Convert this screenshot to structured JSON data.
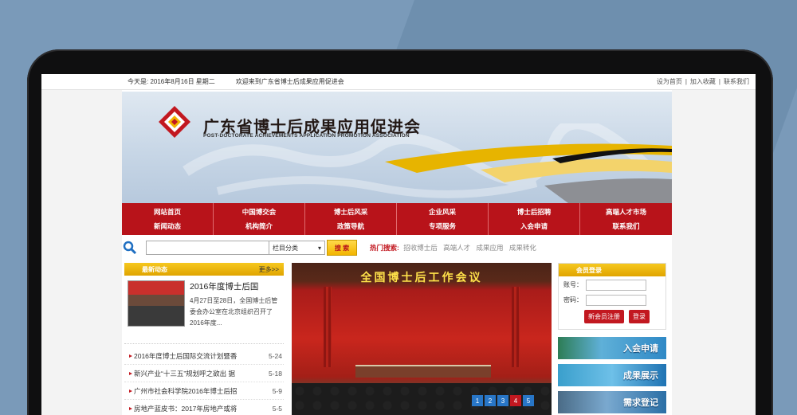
{
  "topbar": {
    "date": "今天是: 2016年8月16日 星期二",
    "welcome": "欢迎来到广东省博士后成果应用促进会",
    "link1": "设为首页",
    "link2": "加入收藏",
    "link3": "联系我们",
    "sep": "|"
  },
  "header": {
    "title": "广东省博士后成果应用促进会",
    "subtitle": "POST-DOCTORATE ACHIEVEMENTS APPLICATION PROMOTION ASSOCIATION"
  },
  "nav": [
    {
      "top": "网站首页",
      "bottom": "新闻动态"
    },
    {
      "top": "中国博交会",
      "bottom": "机构简介"
    },
    {
      "top": "博士后风采",
      "bottom": "政策导航"
    },
    {
      "top": "企业风采",
      "bottom": "专项服务"
    },
    {
      "top": "博士后招聘",
      "bottom": "入会申请"
    },
    {
      "top": "高端人才市场",
      "bottom": "联系我们"
    }
  ],
  "search": {
    "category": "栏目分类",
    "button": "搜 索",
    "hot_label": "热门搜索:",
    "keywords": [
      "招收博士后",
      "高端人才",
      "成果应用",
      "成果转化"
    ]
  },
  "news": {
    "title": "最新动态",
    "more": "更多>>",
    "feature_title": "2016年度博士后国",
    "feature_summary": "4月27日至28日，全国博士后管委会办公室在北京组织召开了2016年度...",
    "items": [
      {
        "text": "2016年度博士后国际交流计划暨香",
        "date": "5-24"
      },
      {
        "text": "新兴产业“十三五”规划呼之欲出 据",
        "date": "5-18"
      },
      {
        "text": "广州市社会科学院2016年博士后招",
        "date": "5-9"
      },
      {
        "text": "房地产蓝皮书：2017年房地产或将",
        "date": "5-5"
      }
    ]
  },
  "slide": {
    "banner": "全国博士后工作会议",
    "pages": [
      "1",
      "2",
      "3",
      "4",
      "5"
    ],
    "active_page": "4"
  },
  "login": {
    "title": "会员登录",
    "user_label": "账号：",
    "pass_label": "密码：",
    "register": "新会员注册",
    "login": "登录"
  },
  "promos": [
    "入会申请",
    "成果展示",
    "需求登记"
  ],
  "colors": {
    "brand_red": "#b8131a",
    "gold": "#f2b400",
    "blue": "#2876c7"
  }
}
